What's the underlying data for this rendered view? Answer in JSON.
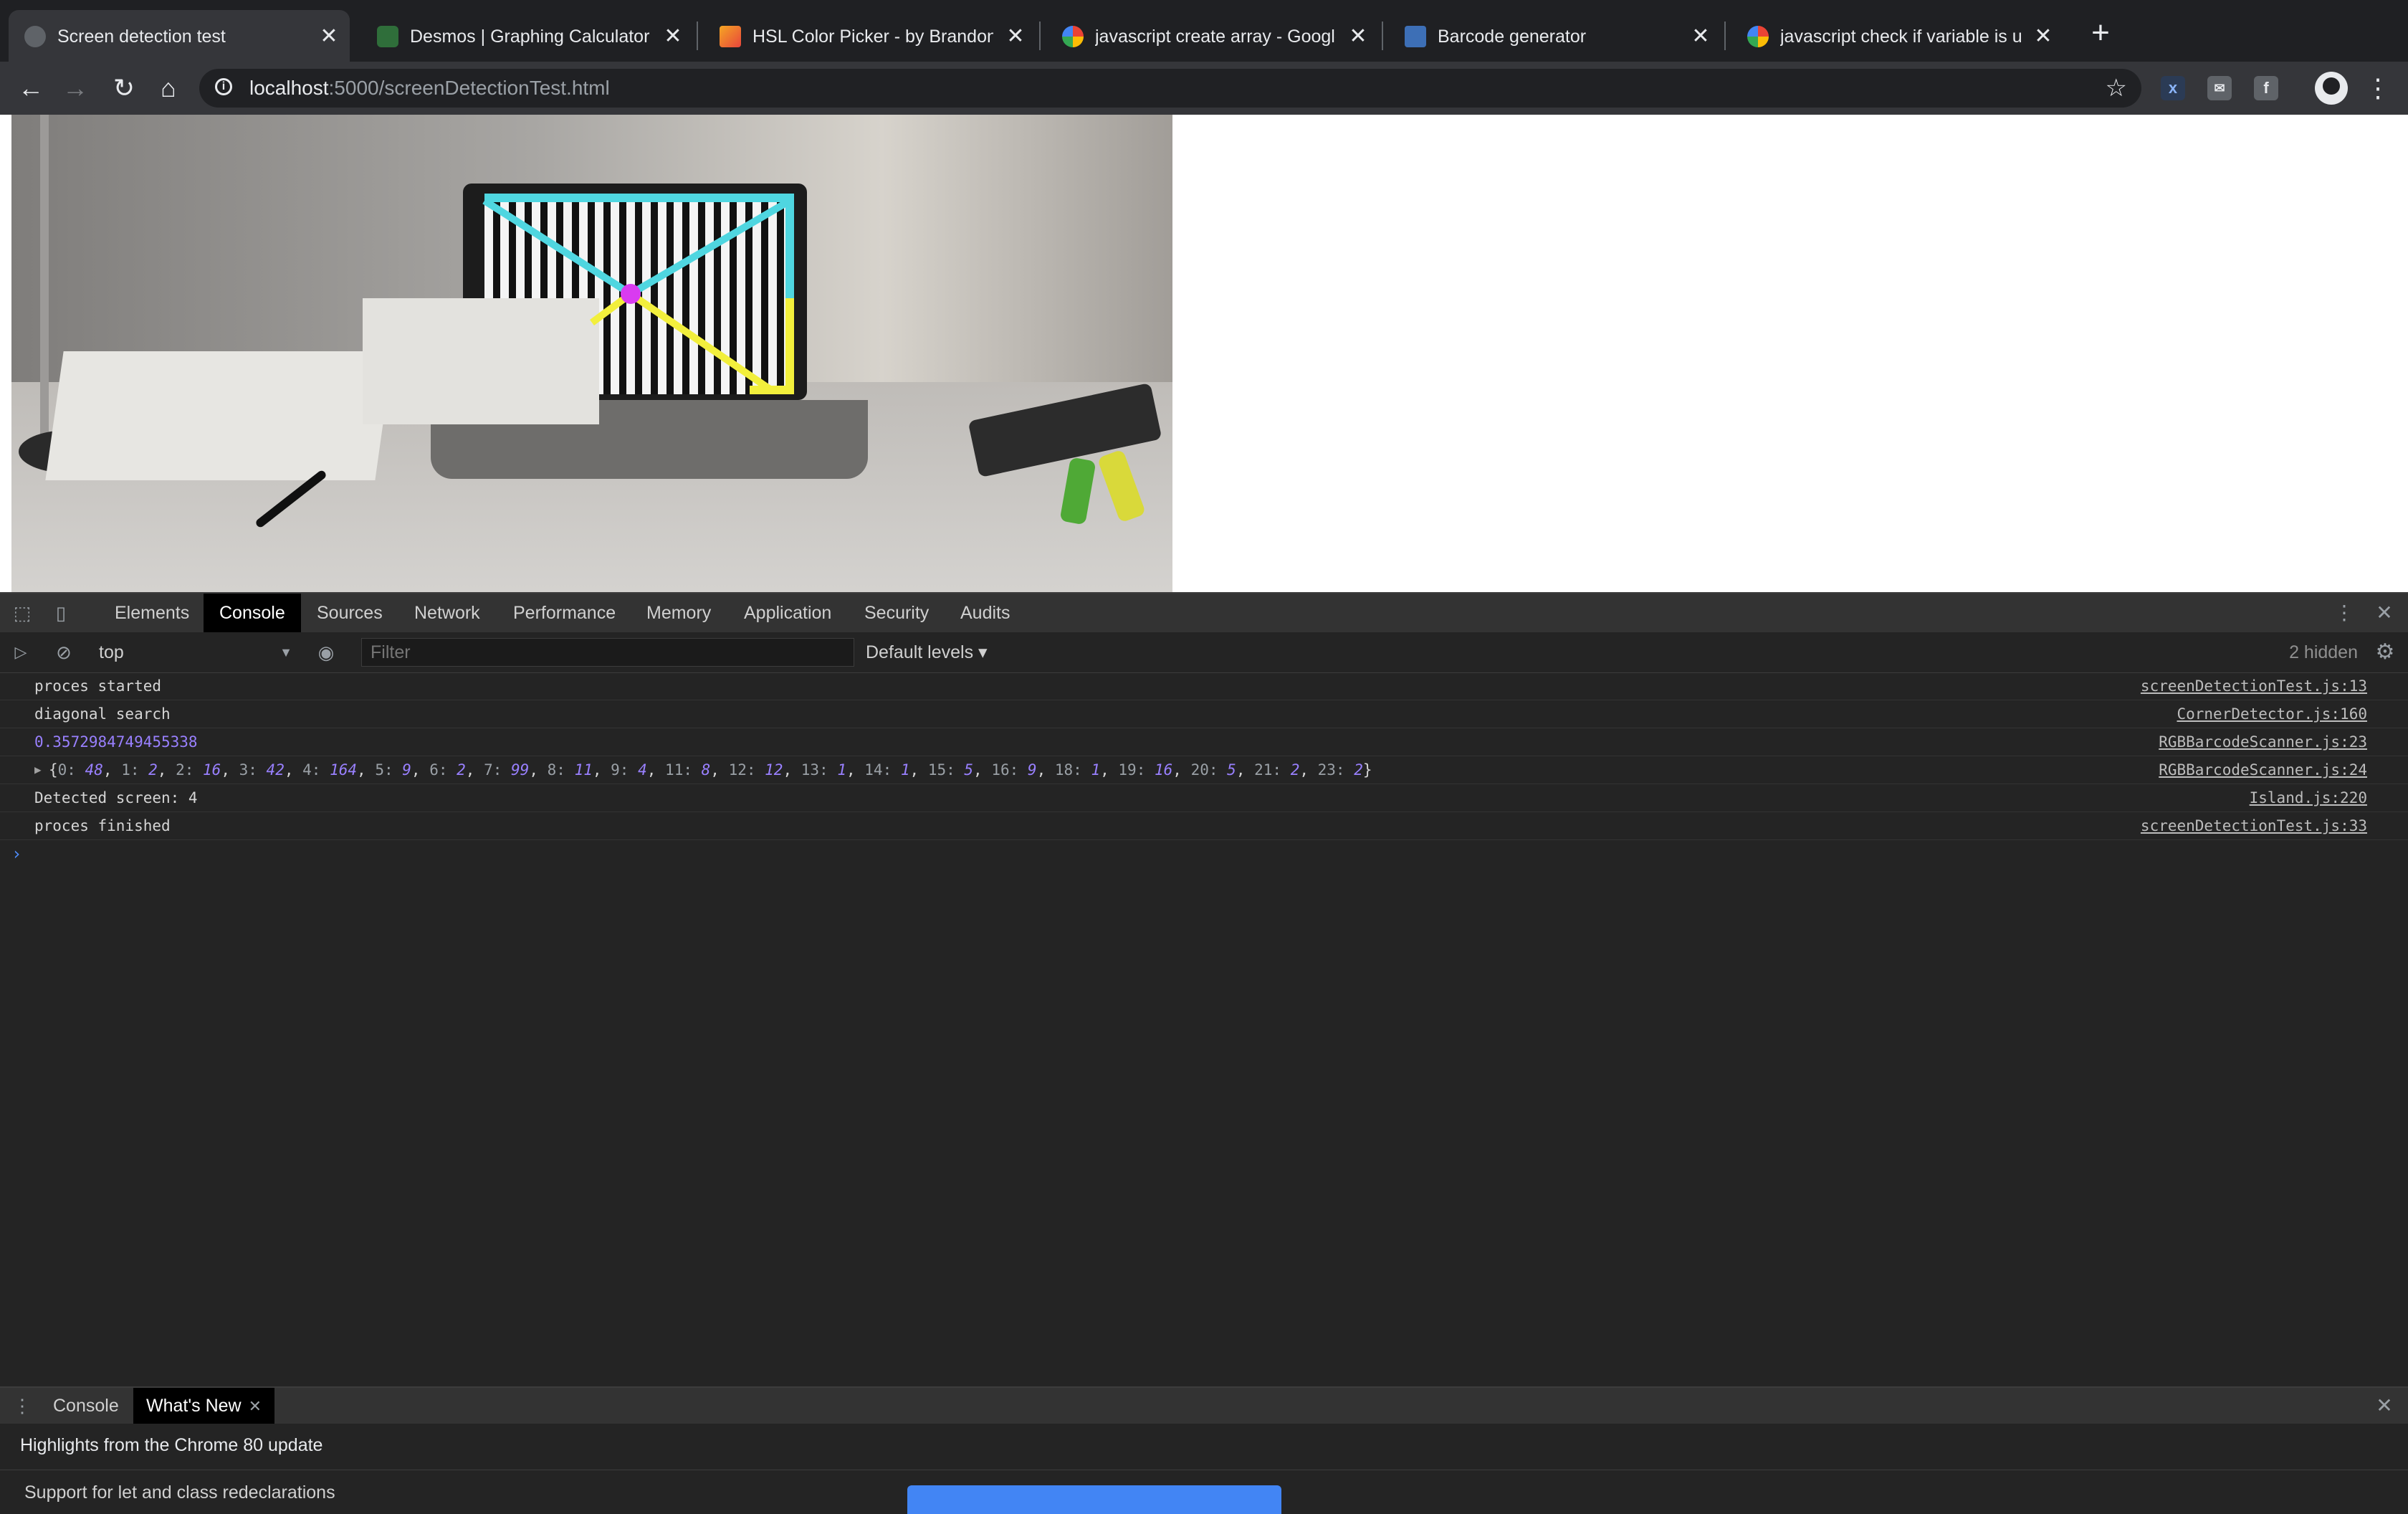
{
  "browser": {
    "tabs": [
      {
        "title": "Screen detection test",
        "active": true,
        "icon": "page-globe-icon"
      },
      {
        "title": "Desmos | Graphing Calculator",
        "active": false,
        "icon": "desmos-icon"
      },
      {
        "title": "HSL Color Picker - by Brandon M",
        "active": false,
        "icon": "color-picker-icon"
      },
      {
        "title": "javascript create array - Google S",
        "active": false,
        "icon": "google-icon"
      },
      {
        "title": "Barcode generator",
        "active": false,
        "icon": "barcode-site-icon"
      },
      {
        "title": "javascript check if variable is und",
        "active": false,
        "icon": "google-icon"
      }
    ],
    "close_glyph": "✕",
    "new_tab_glyph": "+",
    "url_host": "localhost",
    "url_path": ":5000/screenDetectionTest.html"
  },
  "devtools": {
    "tabs": [
      "Elements",
      "Console",
      "Sources",
      "Network",
      "Performance",
      "Memory",
      "Application",
      "Security",
      "Audits"
    ],
    "active_tab": "Console",
    "context": "top",
    "filter_placeholder": "Filter",
    "levels": "Default levels ▾",
    "hidden": "2 hidden",
    "messages": [
      {
        "text": "proces started",
        "source": "screenDetectionTest.js:13"
      },
      {
        "text": "diagonal search",
        "source": "CornerDetector.js:160"
      },
      {
        "number": "0.3572984749455338",
        "source": "RGBBarcodeScanner.js:23"
      },
      {
        "object_label": "{0: 48, 1: 2, 2: 16, 3: 42, 4: 164, 5: 9, 6: 2, 7: 99, 8: 11, 9: 4, 11: 8, 12: 12, 13: 1, 14: 1, 15: 5, 16: 9, 18: 1, 19: 16, 20: 5, 21: 2, 23: 2}",
        "source": "RGBBarcodeScanner.js:24"
      },
      {
        "text": "Detected screen: 4",
        "source": "Island.js:220"
      },
      {
        "text": "proces finished",
        "source": "screenDetectionTest.js:33"
      }
    ],
    "prompt": "›",
    "drawer": {
      "tabs": [
        "Console",
        "What's New"
      ],
      "active_tab": "What's New",
      "heading": "Highlights from the Chrome 80 update",
      "item": "Support for let and class redeclarations"
    }
  },
  "colors": {
    "accent_blue": "#4e8bf7",
    "console_number": "#9980ff",
    "overlay_cyan": "#4fd6e0",
    "overlay_yellow": "#f2ef3c",
    "overlay_magenta": "#d93bf0"
  }
}
